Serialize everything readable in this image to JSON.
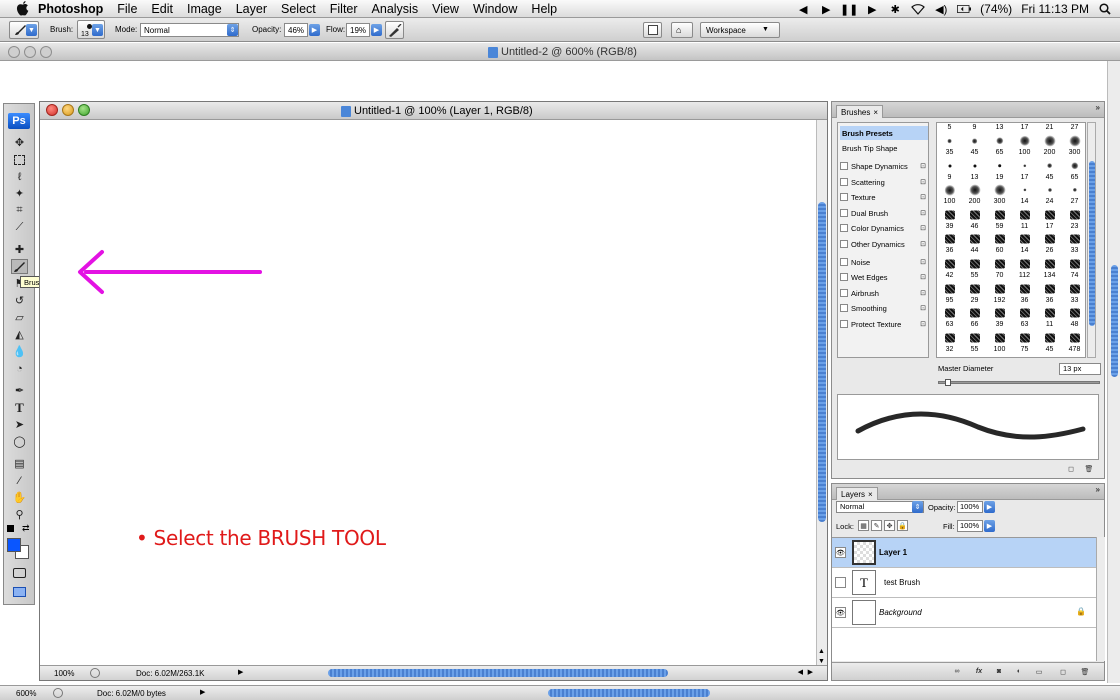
{
  "menubar": {
    "app_name": "Photoshop",
    "items": [
      "File",
      "Edit",
      "Image",
      "Layer",
      "Select",
      "Filter",
      "Analysis",
      "View",
      "Window",
      "Help"
    ],
    "battery": "(74%)",
    "clock": "Fri 11:13 PM"
  },
  "options_bar": {
    "brush_label": "Brush:",
    "brush_size": "13",
    "mode_label": "Mode:",
    "mode_value": "Normal",
    "opacity_label": "Opacity:",
    "opacity_value": "46%",
    "flow_label": "Flow:",
    "flow_value": "19%",
    "workspace_label": "Workspace"
  },
  "background_document": {
    "title": "Untitled-2 @ 600% (RGB/8)",
    "zoom": "600%",
    "doc_info": "Doc: 6.02M/0 bytes"
  },
  "document": {
    "title": "Untitled-1 @ 100% (Layer 1, RGB/8)",
    "zoom": "100%",
    "doc_info": "Doc: 6.02M/263.1K",
    "instruction": "• Select the BRUSH TOOL"
  },
  "tooltip": "Brush Tool (B)",
  "colors": {
    "arrow": "#e312e3",
    "instruction_text": "#e01a1a",
    "foreground_swatch": "#0a56ff",
    "selected_row": "#b7d3f6"
  },
  "brushes_panel": {
    "tab": "Brushes",
    "options": [
      {
        "label": "Brush Presets",
        "checkbox": false,
        "lock": false,
        "selected": true
      },
      {
        "label": "Brush Tip Shape",
        "checkbox": false,
        "lock": false,
        "selected": false
      },
      {
        "label": "Shape Dynamics",
        "checkbox": true,
        "lock": true,
        "selected": false
      },
      {
        "label": "Scattering",
        "checkbox": true,
        "lock": true,
        "selected": false
      },
      {
        "label": "Texture",
        "checkbox": true,
        "lock": true,
        "selected": false
      },
      {
        "label": "Dual Brush",
        "checkbox": true,
        "lock": true,
        "selected": false
      },
      {
        "label": "Color Dynamics",
        "checkbox": true,
        "lock": true,
        "selected": false
      },
      {
        "label": "Other Dynamics",
        "checkbox": true,
        "lock": true,
        "selected": false
      },
      {
        "label": "Noise",
        "checkbox": true,
        "lock": true,
        "selected": false
      },
      {
        "label": "Wet Edges",
        "checkbox": true,
        "lock": true,
        "selected": false
      },
      {
        "label": "Airbrush",
        "checkbox": true,
        "lock": true,
        "selected": false
      },
      {
        "label": "Smoothing",
        "checkbox": true,
        "lock": true,
        "selected": false
      },
      {
        "label": "Protect Texture",
        "checkbox": true,
        "lock": true,
        "selected": false
      }
    ],
    "header_sizes": [
      "5",
      "9",
      "13",
      "17",
      "21",
      "27"
    ],
    "preset_sizes": [
      [
        "35",
        "45",
        "65",
        "100",
        "200",
        "300"
      ],
      [
        "9",
        "13",
        "19",
        "17",
        "45",
        "65"
      ],
      [
        "100",
        "200",
        "300",
        "14",
        "24",
        "27"
      ],
      [
        "39",
        "46",
        "59",
        "11",
        "17",
        "23"
      ],
      [
        "36",
        "44",
        "60",
        "14",
        "26",
        "33"
      ],
      [
        "42",
        "55",
        "70",
        "112",
        "134",
        "74"
      ],
      [
        "95",
        "29",
        "192",
        "36",
        "36",
        "33"
      ],
      [
        "63",
        "66",
        "39",
        "63",
        "11",
        "48"
      ],
      [
        "32",
        "55",
        "100",
        "75",
        "45",
        "478"
      ]
    ],
    "master_diameter_label": "Master Diameter",
    "master_diameter_value": "13 px"
  },
  "layers_panel": {
    "tab": "Layers",
    "blend_mode": "Normal",
    "opacity_label": "Opacity:",
    "opacity_value": "100%",
    "lock_label": "Lock:",
    "fill_label": "Fill:",
    "fill_value": "100%",
    "layers": [
      {
        "name": "Layer 1",
        "visible": true,
        "selected": true
      },
      {
        "name": "test Brush",
        "visible": false,
        "selected": false
      },
      {
        "name": "Background",
        "visible": true,
        "selected": false
      }
    ]
  }
}
